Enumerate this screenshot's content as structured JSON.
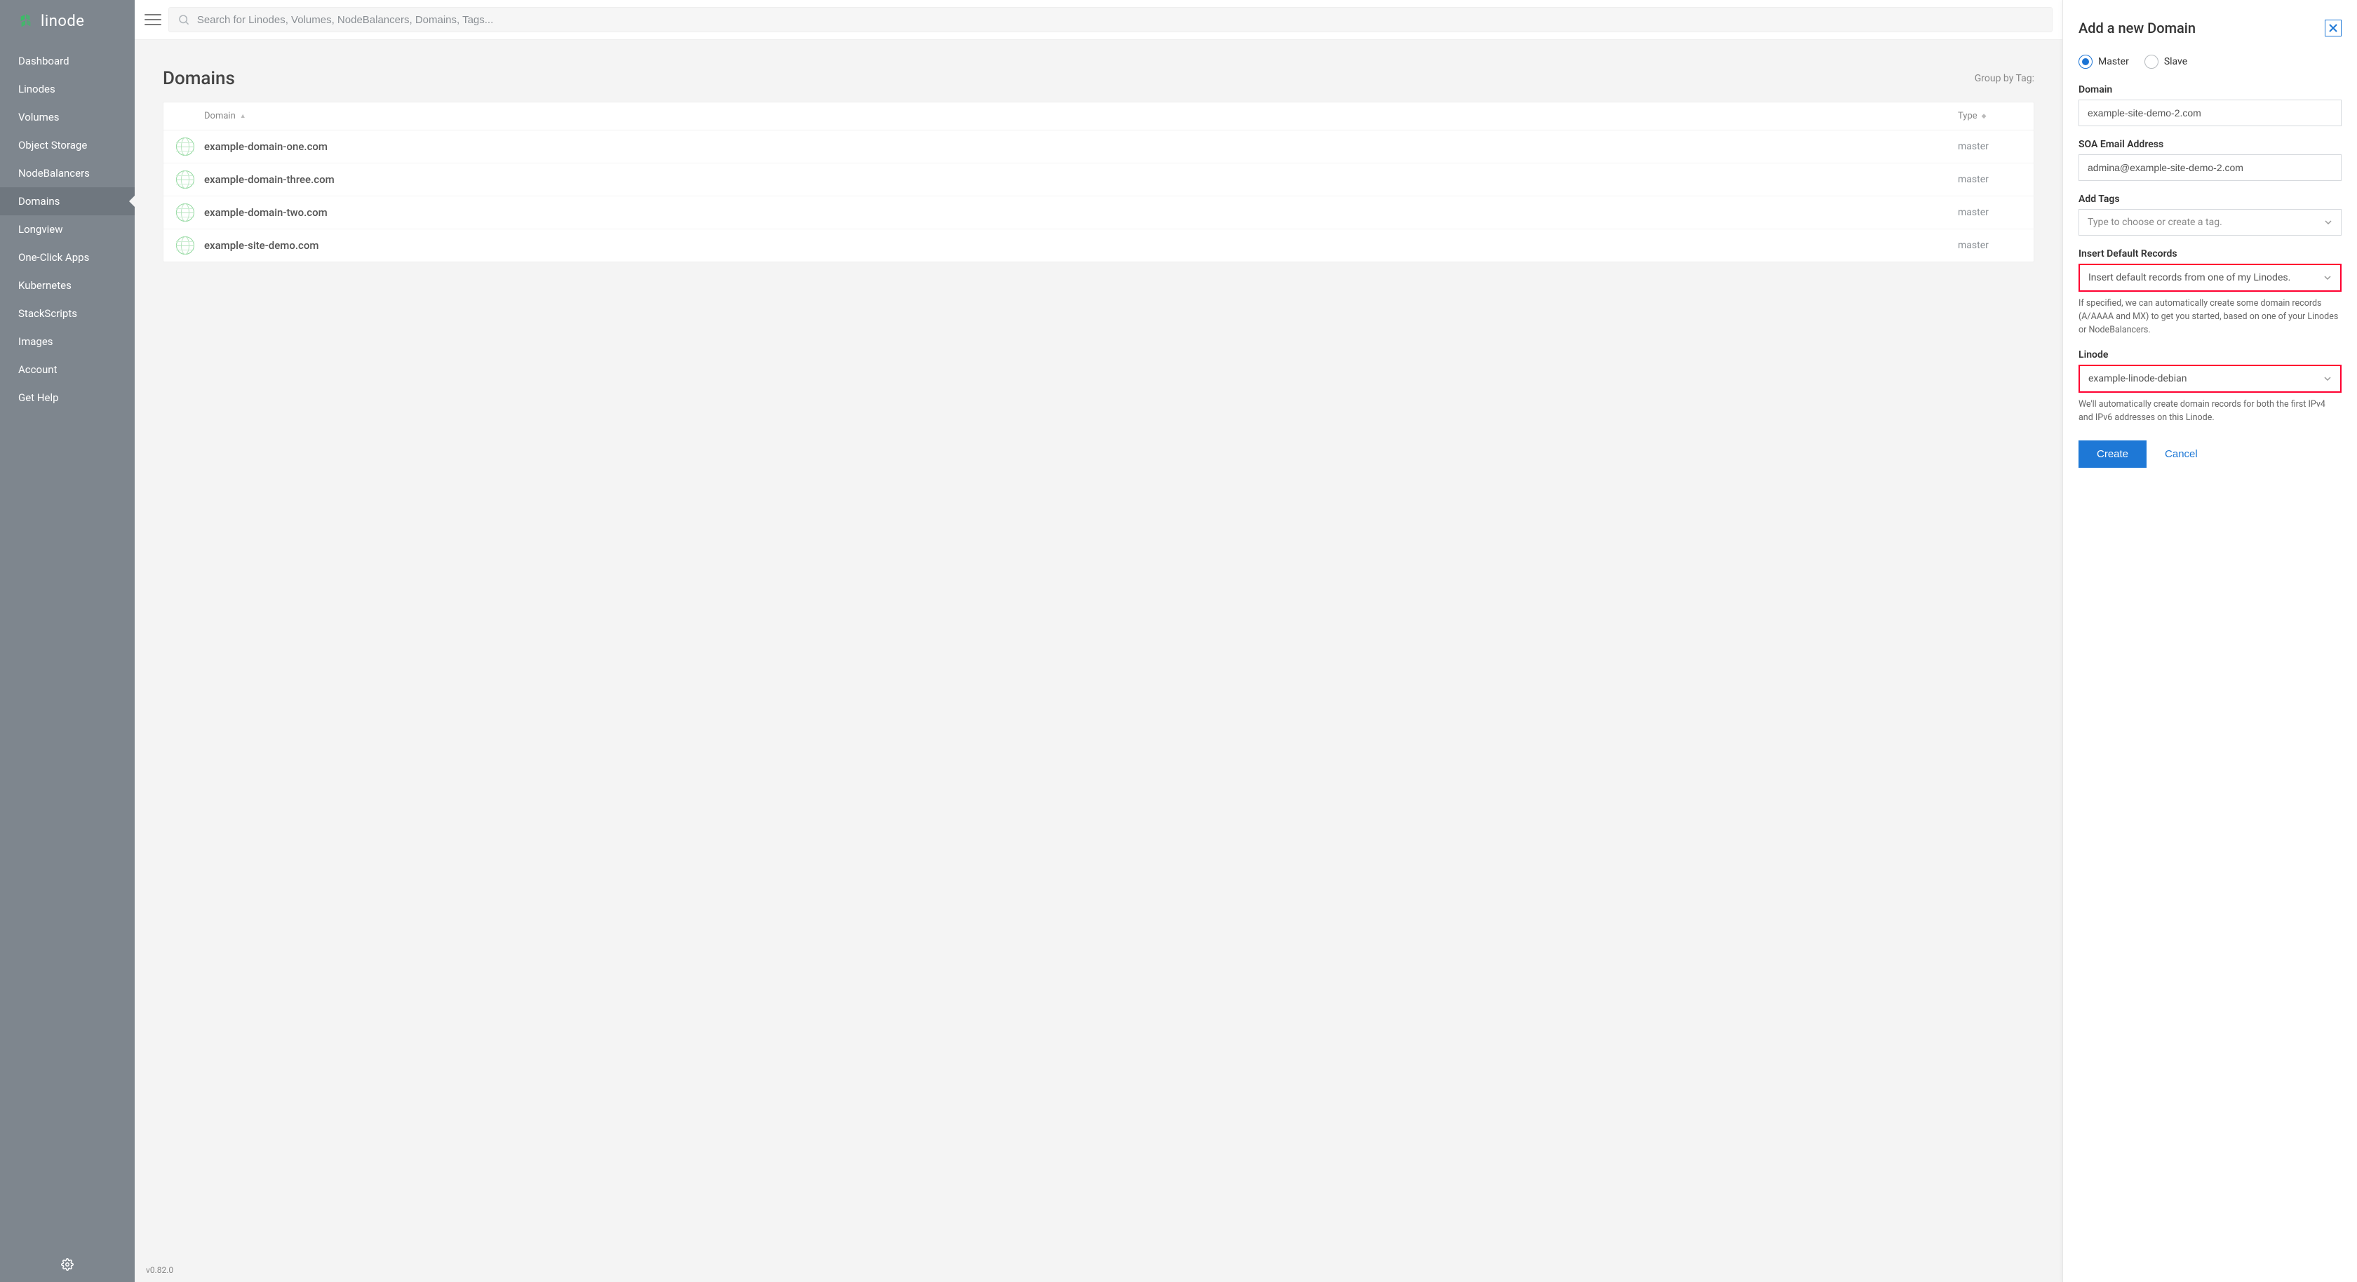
{
  "brand": "linode",
  "sidebar": {
    "items": [
      {
        "label": "Dashboard"
      },
      {
        "label": "Linodes"
      },
      {
        "label": "Volumes"
      },
      {
        "label": "Object Storage"
      },
      {
        "label": "NodeBalancers"
      },
      {
        "label": "Domains"
      },
      {
        "label": "Longview"
      },
      {
        "label": "One-Click Apps"
      },
      {
        "label": "Kubernetes"
      },
      {
        "label": "StackScripts"
      },
      {
        "label": "Images"
      },
      {
        "label": "Account"
      },
      {
        "label": "Get Help"
      }
    ],
    "activeIndex": 5
  },
  "search": {
    "placeholder": "Search for Linodes, Volumes, NodeBalancers, Domains, Tags..."
  },
  "page": {
    "title": "Domains",
    "groupByLabel": "Group by Tag:",
    "columns": {
      "domain": "Domain",
      "type": "Type"
    },
    "rows": [
      {
        "domain": "example-domain-one.com",
        "type": "master"
      },
      {
        "domain": "example-domain-three.com",
        "type": "master"
      },
      {
        "domain": "example-domain-two.com",
        "type": "master"
      },
      {
        "domain": "example-site-demo.com",
        "type": "master"
      }
    ]
  },
  "footer": {
    "version": "v0.82.0"
  },
  "drawer": {
    "title": "Add a new Domain",
    "radio": {
      "master": "Master",
      "slave": "Slave",
      "checked": "master"
    },
    "domain": {
      "label": "Domain",
      "value": "example-site-demo-2.com"
    },
    "soa": {
      "label": "SOA Email Address",
      "value": "admina@example-site-demo-2.com"
    },
    "tags": {
      "label": "Add Tags",
      "placeholder": "Type to choose or create a tag."
    },
    "insert": {
      "label": "Insert Default Records",
      "value": "Insert default records from one of my Linodes.",
      "help": "If specified, we can automatically create some domain records (A/AAAA and MX) to get you started, based on one of your Linodes or NodeBalancers."
    },
    "linode": {
      "label": "Linode",
      "value": "example-linode-debian",
      "help": "We'll automatically create domain records for both the first IPv4 and IPv6 addresses on this Linode."
    },
    "actions": {
      "create": "Create",
      "cancel": "Cancel"
    }
  }
}
